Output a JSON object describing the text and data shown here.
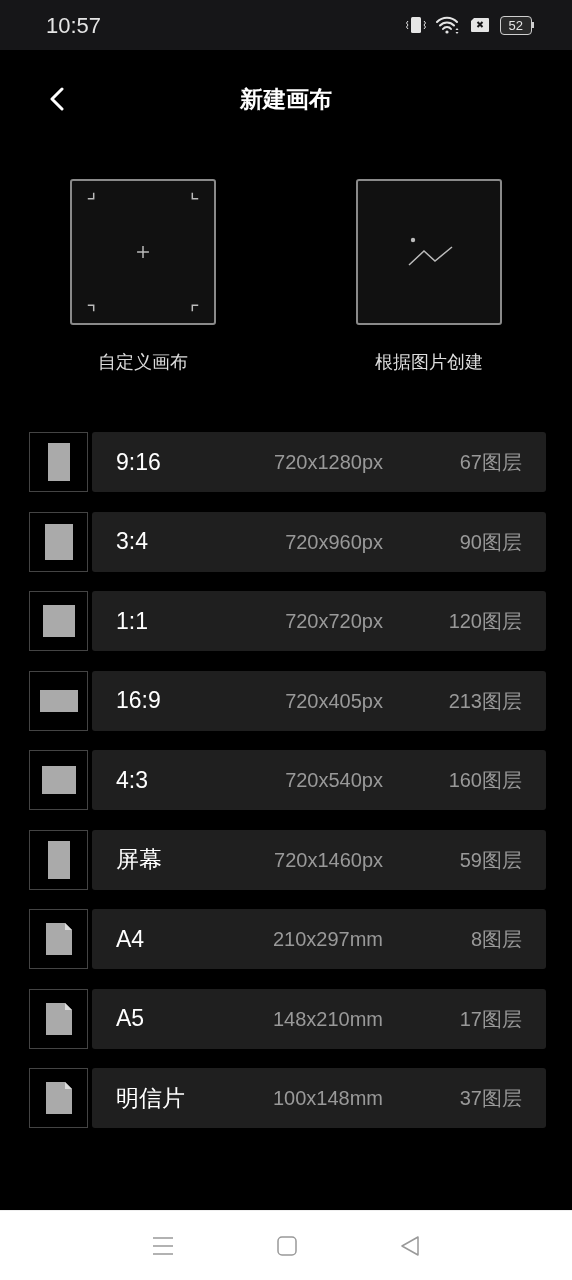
{
  "status_bar": {
    "time": "10:57",
    "battery": "52"
  },
  "header": {
    "title": "新建画布"
  },
  "options": [
    {
      "label": "自定义画布",
      "kind": "custom"
    },
    {
      "label": "根据图片创建",
      "kind": "image"
    }
  ],
  "presets": [
    {
      "name": "9:16",
      "size": "720x1280px",
      "layers": "67图层",
      "kind": "tall"
    },
    {
      "name": "3:4",
      "size": "720x960px",
      "layers": "90图层",
      "kind": "portrait"
    },
    {
      "name": "1:1",
      "size": "720x720px",
      "layers": "120图层",
      "kind": "square"
    },
    {
      "name": "16:9",
      "size": "720x405px",
      "layers": "213图层",
      "kind": "wide"
    },
    {
      "name": "4:3",
      "size": "720x540px",
      "layers": "160图层",
      "kind": "landscape"
    },
    {
      "name": "屏幕",
      "size": "720x1460px",
      "layers": "59图层",
      "kind": "tall"
    },
    {
      "name": "A4",
      "size": "210x297mm",
      "layers": "8图层",
      "kind": "paper"
    },
    {
      "name": "A5",
      "size": "148x210mm",
      "layers": "17图层",
      "kind": "paper"
    },
    {
      "name": "明信片",
      "size": "100x148mm",
      "layers": "37图层",
      "kind": "paper"
    }
  ]
}
